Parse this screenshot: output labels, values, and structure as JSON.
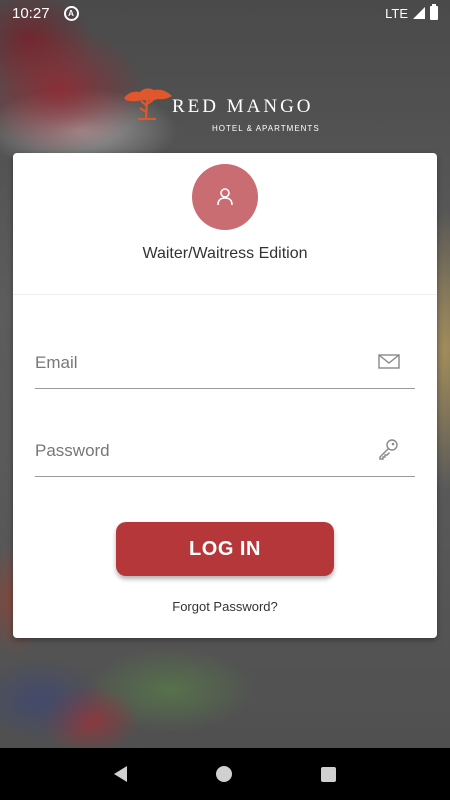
{
  "status_bar": {
    "time": "10:27",
    "network": "LTE",
    "icons": [
      "sync-icon",
      "signal-icon",
      "battery-icon"
    ]
  },
  "brand": {
    "name": "RED MANGO",
    "tagline": "HOTEL & APARTMENTS",
    "logo_icon": "tree-icon",
    "accent_color": "#e0562d"
  },
  "login_card": {
    "avatar_icon": "user-icon",
    "avatar_color": "#c96d72",
    "edition": "Waiter/Waitress Edition",
    "email": {
      "placeholder": "Email",
      "value": "",
      "icon": "envelope-icon"
    },
    "password": {
      "placeholder": "Password",
      "value": "",
      "icon": "key-icon"
    },
    "login_label": "LOG IN",
    "login_color": "#b5373a",
    "forgot_label": "Forgot Password?"
  },
  "nav_bar": {
    "icons": [
      "back-icon",
      "home-icon",
      "recents-icon"
    ]
  }
}
